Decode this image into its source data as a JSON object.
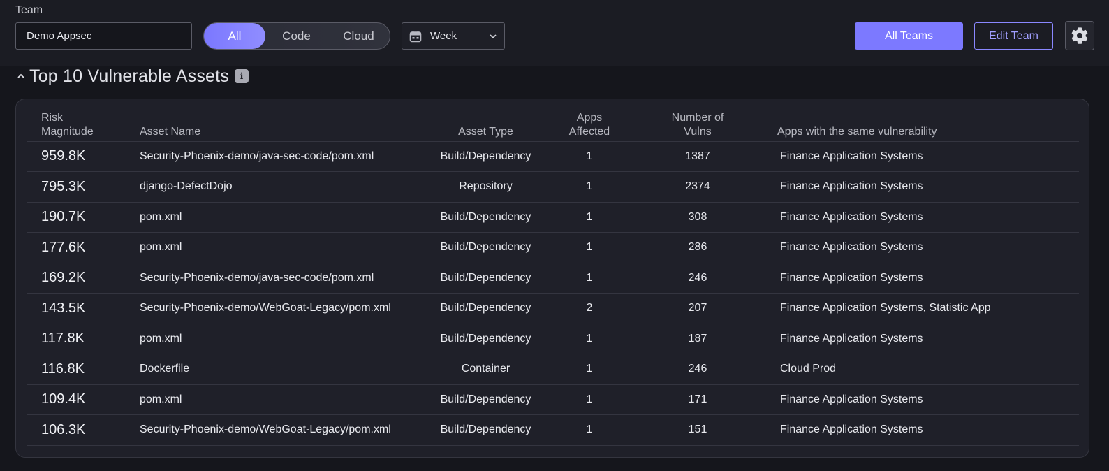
{
  "header": {
    "team_label": "Team",
    "team_value": "Demo Appsec",
    "segments": [
      {
        "label": "All",
        "active": true
      },
      {
        "label": "Code",
        "active": false
      },
      {
        "label": "Cloud",
        "active": false
      }
    ],
    "period": {
      "selected": "Week",
      "icon": "calendar-icon"
    },
    "all_teams_label": "All Teams",
    "edit_team_label": "Edit Team",
    "settings_icon": "gear-icon"
  },
  "section": {
    "title": "Top 10 Vulnerable Assets",
    "info_glyph": "i"
  },
  "table": {
    "columns": {
      "risk_1": "Risk",
      "risk_2": "Magnitude",
      "name": "Asset Name",
      "type": "Asset Type",
      "apps_1": "Apps",
      "apps_2": "Affected",
      "vulns_1": "Number of",
      "vulns_2": "Vulns",
      "same": "Apps with the same vulnerability"
    },
    "rows": [
      {
        "risk": "959.8K",
        "name": "Security-Phoenix-demo/java-sec-code/pom.xml",
        "type": "Build/Dependency",
        "apps": "1",
        "vulns": "1387",
        "same": "Finance Application Systems"
      },
      {
        "risk": "795.3K",
        "name": "django-DefectDojo",
        "type": "Repository",
        "apps": "1",
        "vulns": "2374",
        "same": "Finance Application Systems"
      },
      {
        "risk": "190.7K",
        "name": "pom.xml",
        "type": "Build/Dependency",
        "apps": "1",
        "vulns": "308",
        "same": "Finance Application Systems"
      },
      {
        "risk": "177.6K",
        "name": "pom.xml",
        "type": "Build/Dependency",
        "apps": "1",
        "vulns": "286",
        "same": "Finance Application Systems"
      },
      {
        "risk": "169.2K",
        "name": "Security-Phoenix-demo/java-sec-code/pom.xml",
        "type": "Build/Dependency",
        "apps": "1",
        "vulns": "246",
        "same": "Finance Application Systems"
      },
      {
        "risk": "143.5K",
        "name": "Security-Phoenix-demo/WebGoat-Legacy/pom.xml",
        "type": "Build/Dependency",
        "apps": "2",
        "vulns": "207",
        "same": "Finance Application Systems, Statistic App"
      },
      {
        "risk": "117.8K",
        "name": "pom.xml",
        "type": "Build/Dependency",
        "apps": "1",
        "vulns": "187",
        "same": "Finance Application Systems"
      },
      {
        "risk": "116.8K",
        "name": "Dockerfile",
        "type": "Container",
        "apps": "1",
        "vulns": "246",
        "same": "Cloud Prod"
      },
      {
        "risk": "109.4K",
        "name": "pom.xml",
        "type": "Build/Dependency",
        "apps": "1",
        "vulns": "171",
        "same": "Finance Application Systems"
      },
      {
        "risk": "106.3K",
        "name": "Security-Phoenix-demo/WebGoat-Legacy/pom.xml",
        "type": "Build/Dependency",
        "apps": "1",
        "vulns": "151",
        "same": "Finance Application Systems"
      }
    ]
  },
  "colors": {
    "accent": "#7c79ff",
    "background": "#15161c",
    "card": "#1f2029"
  }
}
